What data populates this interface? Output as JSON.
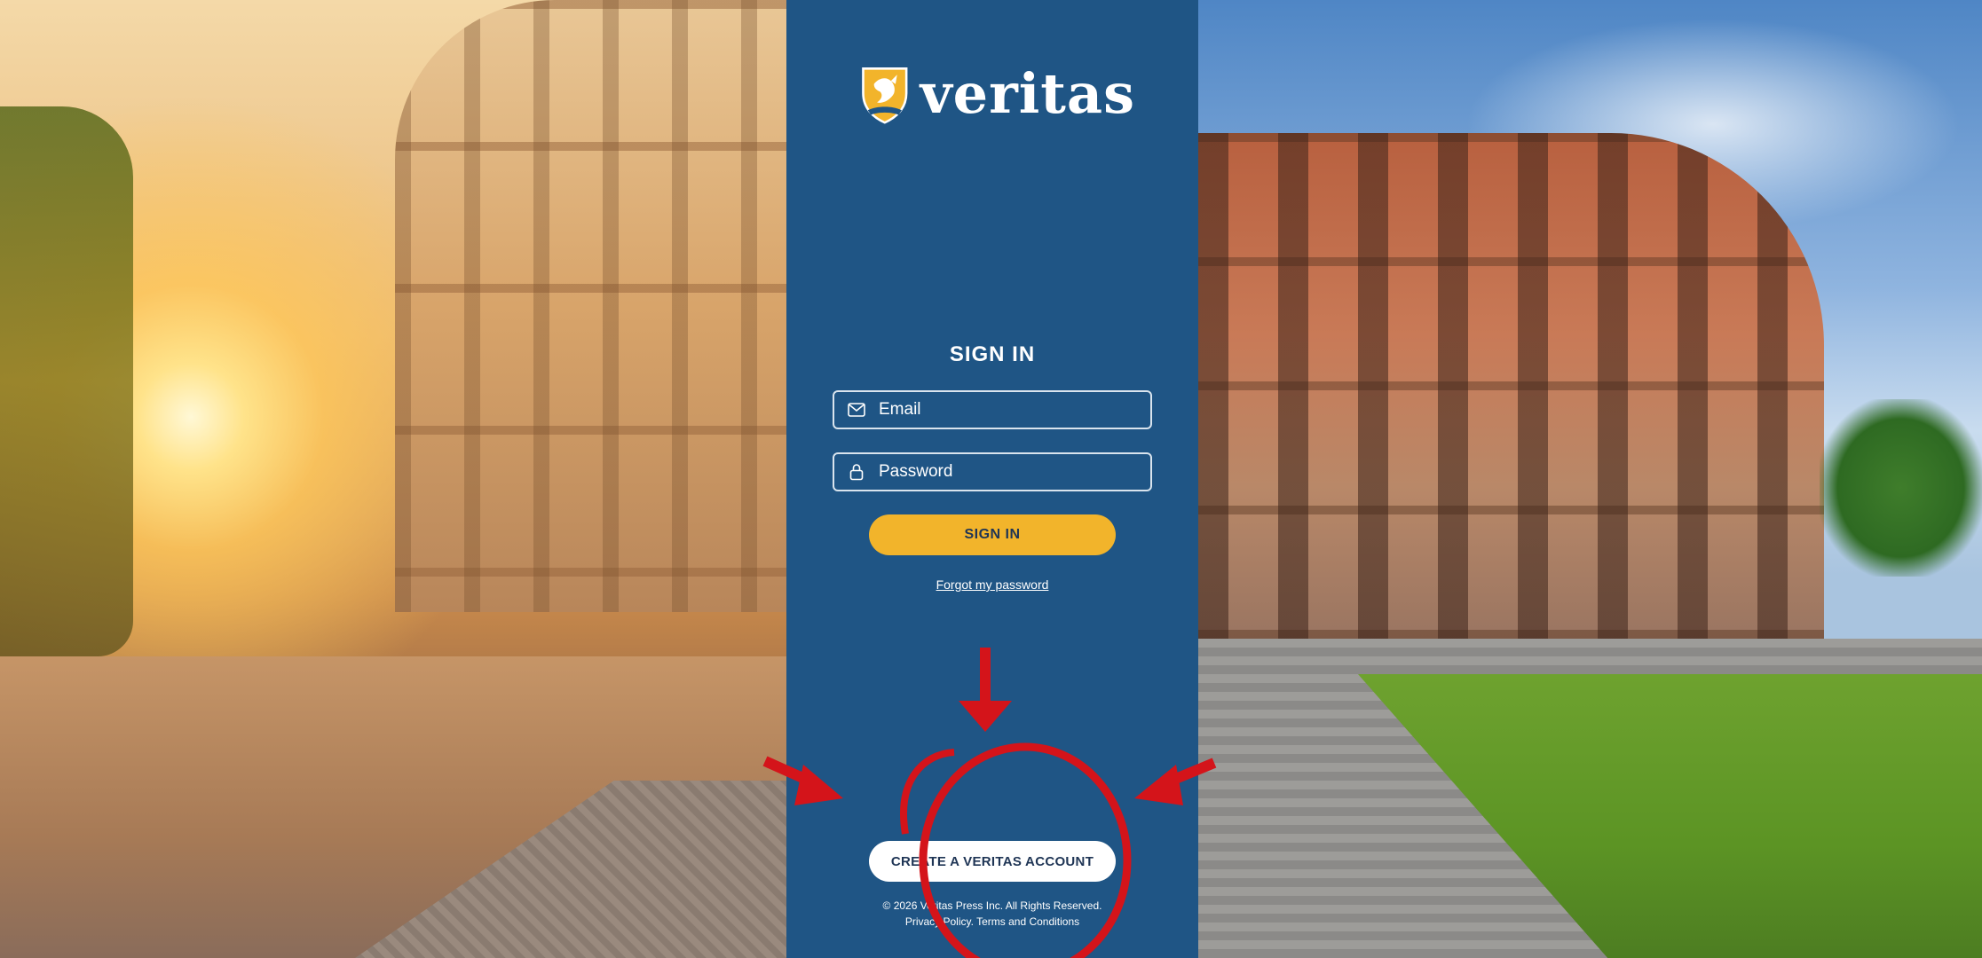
{
  "brand": {
    "name": "veritas",
    "logo_icon": "griffin-shield-icon",
    "colors": {
      "panel": "#1f5585",
      "accent": "#f2b42b",
      "annotation": "#d4141a"
    }
  },
  "signin": {
    "title": "SIGN IN",
    "email": {
      "placeholder": "Email",
      "value": "",
      "icon": "envelope-icon"
    },
    "password": {
      "placeholder": "Password",
      "value": "",
      "icon": "lock-icon"
    },
    "submit_label": "SIGN IN",
    "forgot_label": "Forgot my password"
  },
  "create_account": {
    "label": "CREATE A VERITAS ACCOUNT"
  },
  "footer": {
    "copyright": "© 2026 Veritas Press Inc. All Rights Reserved.",
    "privacy": "Privacy Policy.",
    "terms": "Terms and Conditions"
  }
}
